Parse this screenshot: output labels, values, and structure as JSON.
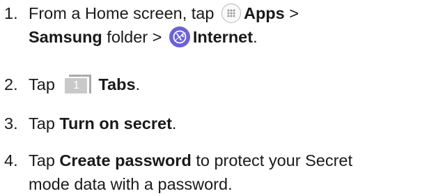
{
  "steps": [
    {
      "number": "1.",
      "line1": {
        "t1": "From a Home screen, tap",
        "apps": "Apps",
        "t2": " >"
      },
      "line2": {
        "samsung": "Samsung",
        "t3": " folder >",
        "internet": "Internet",
        "t4": "."
      },
      "icons": [
        "apps-grid-icon",
        "samsung-internet-icon"
      ]
    },
    {
      "number": "2.",
      "t1": "Tap",
      "tabs_icon_number": "1",
      "bold": "Tabs",
      "t2": ".",
      "icons": [
        "tabs-icon"
      ]
    },
    {
      "number": "3.",
      "t1": "Tap ",
      "bold": "Turn on secret",
      "t2": "."
    },
    {
      "number": "4.",
      "t1": "Tap ",
      "bold": "Create password",
      "t2": " to protect your Secret",
      "line2": "mode data with a password."
    }
  ],
  "colors": {
    "text": "#1a1a1a",
    "internet_icon": "#6b63d4",
    "tabs_icon": "#c9c9c9"
  }
}
